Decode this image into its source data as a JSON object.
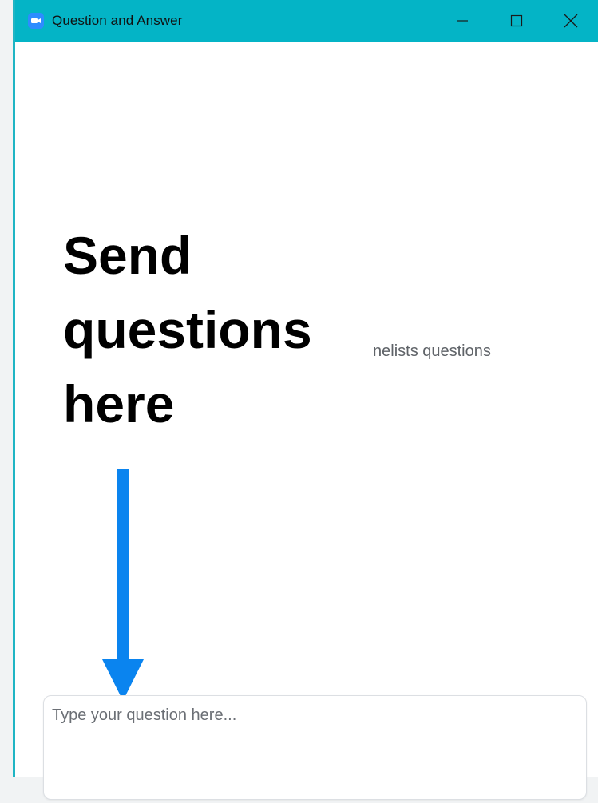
{
  "window": {
    "title": "Question and Answer",
    "controls": {
      "minimize_icon": "minimize-icon",
      "maximize_icon": "maximize-icon",
      "close_icon": "close-icon"
    }
  },
  "main": {
    "empty_hint": "nelists questions"
  },
  "annotation": {
    "text": "Send questions here",
    "arrow_color": "#0a84ef"
  },
  "question_input": {
    "placeholder": "Type your question here..."
  },
  "colors": {
    "titlebar": "#04b4c6",
    "app_icon": "#2d8cff"
  }
}
